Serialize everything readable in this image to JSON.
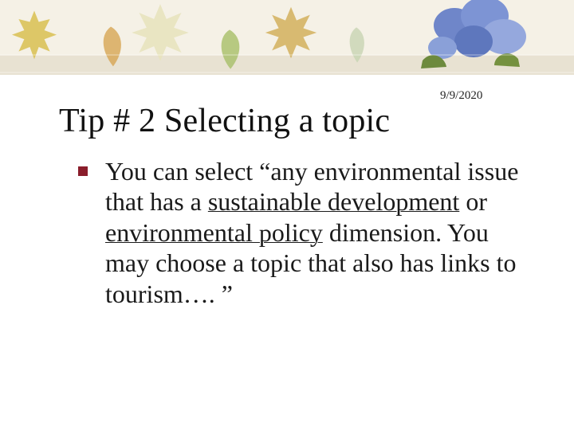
{
  "date": "9/9/2020",
  "title": "Tip # 2 Selecting a topic",
  "body": {
    "segments": [
      {
        "t": "You can select “any environmental issue that has a ",
        "u": false
      },
      {
        "t": "sustainable development",
        "u": true
      },
      {
        "t": " or ",
        "u": false
      },
      {
        "t": "environmental policy",
        "u": true
      },
      {
        "t": " dimension. You may choose a topic that also has links to tourism…. ”",
        "u": false
      }
    ]
  },
  "banner": {
    "bg_top": "#f5f1e6",
    "bg_strip": "#e8e2d2",
    "accent_bullet": "#8a1d2b"
  }
}
